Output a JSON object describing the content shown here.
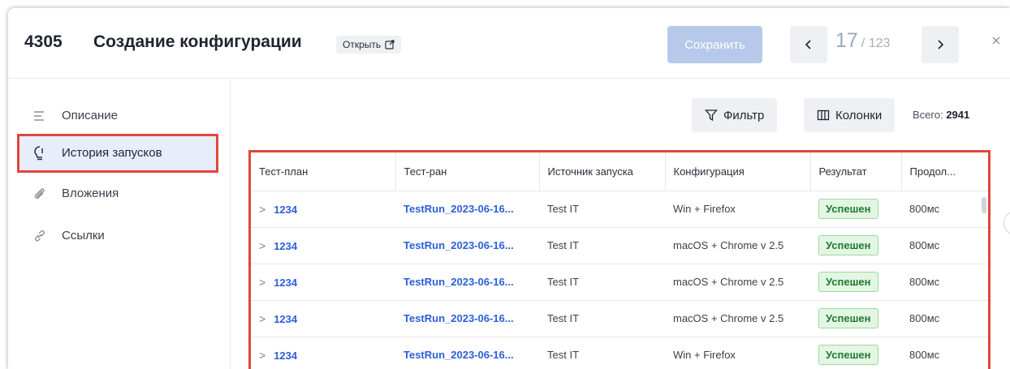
{
  "header": {
    "id": "4305",
    "title": "Создание конфигурации",
    "open_label": "Открыть",
    "save_label": "Сохранить",
    "counter_current": "17",
    "counter_total": "/ 123"
  },
  "sidebar": {
    "items": [
      {
        "label": "Описание",
        "icon": "list-icon"
      },
      {
        "label": "История запусков",
        "icon": "lightbulb-icon",
        "active": true
      },
      {
        "label": "Вложения",
        "icon": "paperclip-icon"
      },
      {
        "label": "Ссылки",
        "icon": "link-icon"
      }
    ]
  },
  "toolbar": {
    "filter_label": "Фильтр",
    "columns_label": "Колонки",
    "total_label": "Всего:",
    "total_value": "2941"
  },
  "table": {
    "columns": [
      "Тест-план",
      "Тест-ран",
      "Источник запуска",
      "Конфигурация",
      "Результат",
      "Продол..."
    ],
    "rows": [
      {
        "plan": "1234",
        "run": "TestRun_2023-06-16...",
        "source": "Test IT",
        "config": "Win + Firefox",
        "result": "Успешен",
        "duration": "800мс"
      },
      {
        "plan": "1234",
        "run": "TestRun_2023-06-16...",
        "source": "Test IT",
        "config": "macOS + Chrome v 2.5",
        "result": "Успешен",
        "duration": "800мс"
      },
      {
        "plan": "1234",
        "run": "TestRun_2023-06-16...",
        "source": "Test IT",
        "config": "macOS + Chrome v 2.5",
        "result": "Успешен",
        "duration": "800мс"
      },
      {
        "plan": "1234",
        "run": "TestRun_2023-06-16...",
        "source": "Test IT",
        "config": "macOS + Chrome v 2.5",
        "result": "Успешен",
        "duration": "800мс"
      },
      {
        "plan": "1234",
        "run": "TestRun_2023-06-16...",
        "source": "Test IT",
        "config": "Win + Firefox",
        "result": "Успешен",
        "duration": "800мс"
      }
    ]
  },
  "colors": {
    "accent": "#2b5fd9",
    "highlight_border": "#e0473a",
    "success_text": "#1f7a32",
    "success_bg": "#e3f6e3",
    "save_disabled": "#b6c9ea"
  }
}
